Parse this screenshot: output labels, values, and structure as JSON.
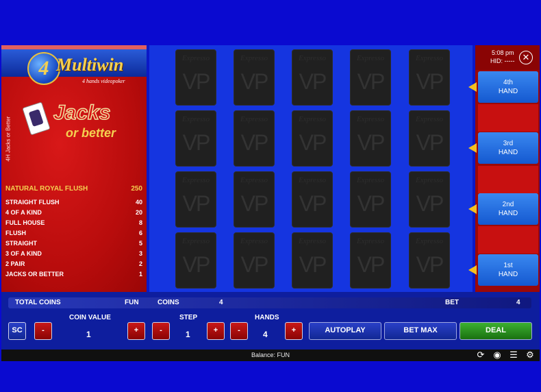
{
  "logo": {
    "number": "4",
    "title": "Multiwin",
    "subtitle": "4 hands videopoker"
  },
  "side_label": "4H Jacks or Better",
  "game_logo": {
    "main": "Jacks",
    "sub": "or better"
  },
  "paytable": [
    {
      "hand": "NATURAL ROYAL FLUSH",
      "pay": "250"
    },
    {
      "hand": "STRAIGHT FLUSH",
      "pay": "40"
    },
    {
      "hand": "4 OF A KIND",
      "pay": "20"
    },
    {
      "hand": "FULL HOUSE",
      "pay": "8"
    },
    {
      "hand": "FLUSH",
      "pay": "6"
    },
    {
      "hand": "STRAIGHT",
      "pay": "5"
    },
    {
      "hand": "3 OF A KIND",
      "pay": "3"
    },
    {
      "hand": "2 PAIR",
      "pay": "2"
    },
    {
      "hand": "JACKS OR BETTER",
      "pay": "1"
    }
  ],
  "card_back": {
    "brand": "Expresso",
    "mark": "VP"
  },
  "header": {
    "time": "5:08 pm",
    "hid": "HID: -----",
    "close_icon": "close-icon"
  },
  "hands": [
    {
      "line1": "4th",
      "line2": "HAND"
    },
    {
      "line1": "3rd",
      "line2": "HAND"
    },
    {
      "line1": "2nd",
      "line2": "HAND"
    },
    {
      "line1": "1st",
      "line2": "HAND"
    }
  ],
  "info_bar": {
    "total_coins_label": "TOTAL COINS",
    "total_coins_value": "FUN",
    "coins_label": "COINS",
    "coins_value": "4",
    "bet_label": "BET",
    "bet_value": "4"
  },
  "controls": {
    "sc_label": "SC",
    "minus": "-",
    "plus": "+",
    "coin_value_label": "COIN VALUE",
    "coin_value": "1",
    "step_label": "STEP",
    "step_value": "1",
    "hands_label": "HANDS",
    "hands_value": "4",
    "autoplay": "AUTOPLAY",
    "bet_max": "BET MAX",
    "deal": "DEAL"
  },
  "status": {
    "balance": "Balance: FUN"
  },
  "icons": [
    "refresh-icon",
    "sound-icon",
    "menu-icon",
    "settings-icon"
  ],
  "colors": {
    "panel_red": "#b80c0c",
    "accent_yellow": "#f4c020",
    "deal_green": "#3cb030",
    "hand_blue": "#1458d0"
  }
}
